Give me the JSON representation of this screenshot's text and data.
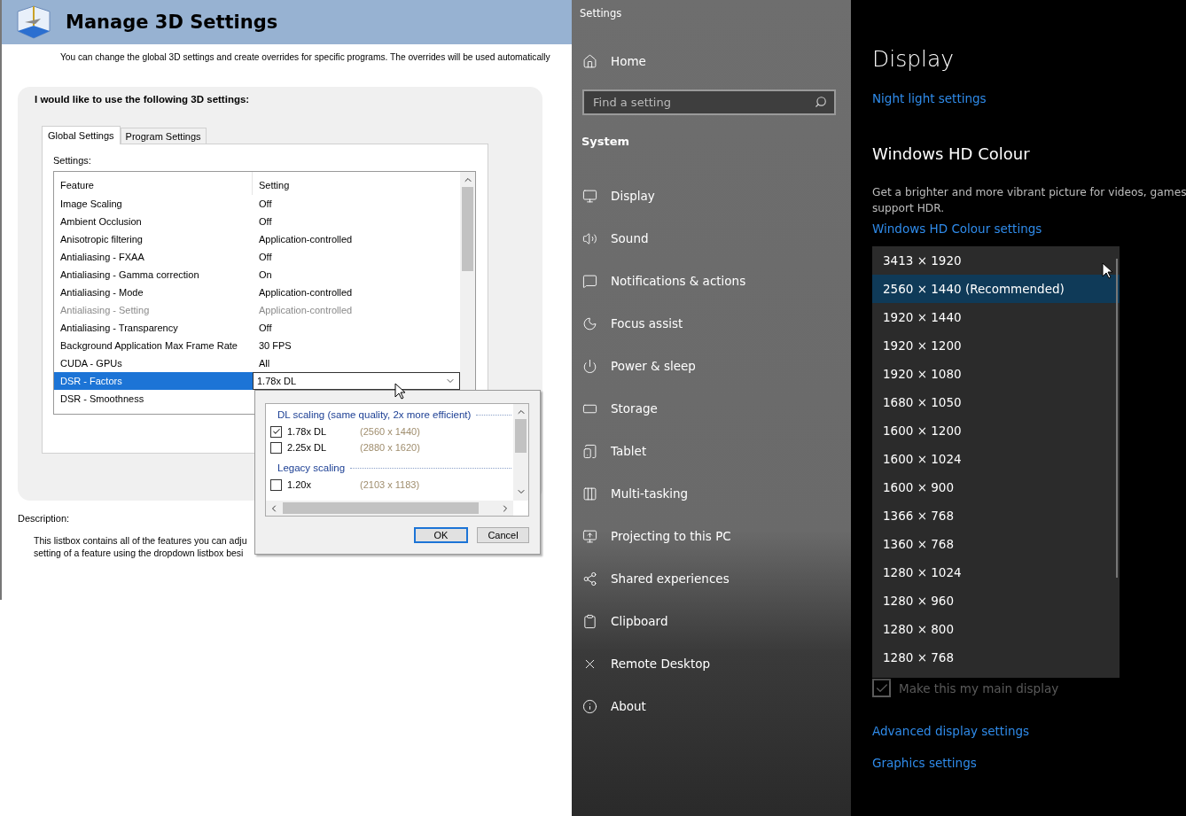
{
  "nvidia": {
    "title": "Manage 3D Settings",
    "intro": "You can change the global 3D settings and create overrides for specific programs. The overrides will be used automatically",
    "group_label": "I would like to use the following 3D settings:",
    "tabs": [
      {
        "label": "Global Settings",
        "selected": true
      },
      {
        "label": "Program Settings",
        "selected": false
      }
    ],
    "settings_label": "Settings:",
    "columns": [
      "Feature",
      "Setting"
    ],
    "rows": [
      {
        "feature": "Image Scaling",
        "setting": "Off",
        "selected": false,
        "disabled": false
      },
      {
        "feature": "Ambient Occlusion",
        "setting": "Off",
        "selected": false,
        "disabled": false
      },
      {
        "feature": "Anisotropic filtering",
        "setting": "Application-controlled",
        "selected": false,
        "disabled": false
      },
      {
        "feature": "Antialiasing - FXAA",
        "setting": "Off",
        "selected": false,
        "disabled": false
      },
      {
        "feature": "Antialiasing - Gamma correction",
        "setting": "On",
        "selected": false,
        "disabled": false
      },
      {
        "feature": "Antialiasing - Mode",
        "setting": "Application-controlled",
        "selected": false,
        "disabled": false
      },
      {
        "feature": "Antialiasing - Setting",
        "setting": "Application-controlled",
        "selected": false,
        "disabled": true
      },
      {
        "feature": "Antialiasing - Transparency",
        "setting": "Off",
        "selected": false,
        "disabled": false
      },
      {
        "feature": "Background Application Max Frame Rate",
        "setting": "30 FPS",
        "selected": false,
        "disabled": false
      },
      {
        "feature": "CUDA - GPUs",
        "setting": "All",
        "selected": false,
        "disabled": false
      },
      {
        "feature": "DSR - Factors",
        "setting": "1.78x DL",
        "selected": true,
        "disabled": false
      },
      {
        "feature": "DSR - Smoothness",
        "setting": "",
        "selected": false,
        "disabled": false
      }
    ],
    "description_label": "Description:",
    "description_lines": [
      "This listbox contains all of the features you can adju",
      "setting of a feature using the dropdown listbox besi"
    ],
    "popup": {
      "items": [
        {
          "kind": "group",
          "label": "DL scaling (same quality, 2x more efficient)"
        },
        {
          "kind": "option",
          "label": "1.78x DL",
          "resolution": "(2560 x 1440)",
          "checked": true
        },
        {
          "kind": "option",
          "label": "2.25x DL",
          "resolution": "(2880 x 1620)",
          "checked": false
        },
        {
          "kind": "group",
          "label": "Legacy scaling"
        },
        {
          "kind": "option",
          "label": "1.20x",
          "resolution": "(2103 x 1183)",
          "checked": false
        }
      ],
      "buttons": [
        "OK",
        "Cancel"
      ]
    }
  },
  "settings": {
    "window_title": "Settings",
    "home": "Home",
    "search": {
      "placeholder": "Find a setting"
    },
    "section": "System",
    "nav": [
      {
        "label": "Display"
      },
      {
        "label": "Sound"
      },
      {
        "label": "Notifications & actions"
      },
      {
        "label": "Focus assist"
      },
      {
        "label": "Power & sleep"
      },
      {
        "label": "Storage"
      },
      {
        "label": "Tablet"
      },
      {
        "label": "Multi-tasking"
      },
      {
        "label": "Projecting to this PC"
      },
      {
        "label": "Shared experiences"
      },
      {
        "label": "Clipboard"
      },
      {
        "label": "Remote Desktop"
      },
      {
        "label": "About"
      }
    ],
    "page_title": "Display",
    "night_link": "Night light settings",
    "hd_heading": "Windows HD Colour",
    "hd_text": [
      "Get a brighter and more vibrant picture for videos, games",
      "support HDR."
    ],
    "hd_link": "Windows HD Colour settings",
    "resolutions": [
      {
        "label": "3413 × 1920",
        "selected": false
      },
      {
        "label": "2560 × 1440 (Recommended)",
        "selected": true
      },
      {
        "label": "1920 × 1440",
        "selected": false
      },
      {
        "label": "1920 × 1200",
        "selected": false
      },
      {
        "label": "1920 × 1080",
        "selected": false
      },
      {
        "label": "1680 × 1050",
        "selected": false
      },
      {
        "label": "1600 × 1200",
        "selected": false
      },
      {
        "label": "1600 × 1024",
        "selected": false
      },
      {
        "label": "1600 × 900",
        "selected": false
      },
      {
        "label": "1366 × 768",
        "selected": false
      },
      {
        "label": "1360 × 768",
        "selected": false
      },
      {
        "label": "1280 × 1024",
        "selected": false
      },
      {
        "label": "1280 × 960",
        "selected": false
      },
      {
        "label": "1280 × 800",
        "selected": false
      },
      {
        "label": "1280 × 768",
        "selected": false
      }
    ],
    "main_display": {
      "label": "Make this my main display",
      "checked": true,
      "disabled": true
    },
    "links": [
      "Advanced display settings",
      "Graphics settings"
    ]
  }
}
